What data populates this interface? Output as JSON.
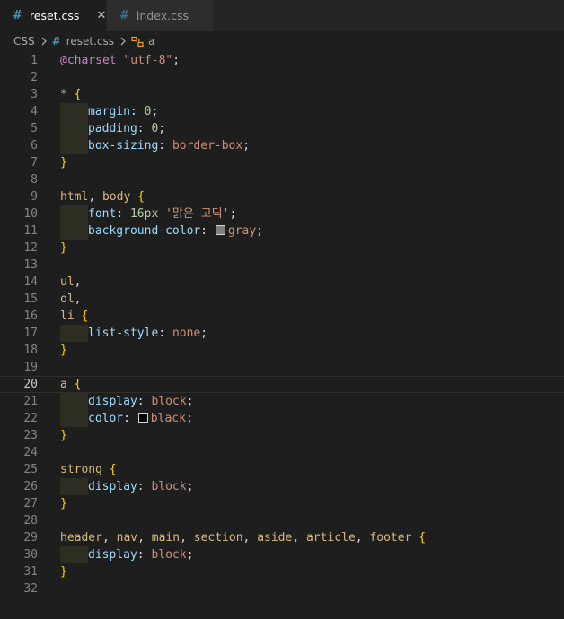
{
  "tabs": [
    {
      "label": "reset.css",
      "active": true,
      "close_glyph": "✕"
    },
    {
      "label": "index.css",
      "active": false
    }
  ],
  "breadcrumb": {
    "root": "CSS",
    "file": "reset.css",
    "symbol": "a"
  },
  "editor": {
    "current_line": 20,
    "lines": [
      {
        "n": "1",
        "indent": false,
        "tokens": [
          [
            "at",
            "@charset"
          ],
          [
            "punc",
            " "
          ],
          [
            "str",
            "\"utf-8\""
          ],
          [
            "punc",
            ";"
          ]
        ]
      },
      {
        "n": "2",
        "indent": false,
        "tokens": []
      },
      {
        "n": "3",
        "indent": false,
        "tokens": [
          [
            "sel",
            "*"
          ],
          [
            "punc",
            " "
          ],
          [
            "brace",
            "{"
          ]
        ]
      },
      {
        "n": "4",
        "indent": true,
        "tokens": [
          [
            "prop",
            "margin"
          ],
          [
            "punc",
            ": "
          ],
          [
            "num",
            "0"
          ],
          [
            "punc",
            ";"
          ]
        ]
      },
      {
        "n": "5",
        "indent": true,
        "tokens": [
          [
            "prop",
            "padding"
          ],
          [
            "punc",
            ": "
          ],
          [
            "num",
            "0"
          ],
          [
            "punc",
            ";"
          ]
        ]
      },
      {
        "n": "6",
        "indent": true,
        "tokens": [
          [
            "prop",
            "box-sizing"
          ],
          [
            "punc",
            ": "
          ],
          [
            "val",
            "border-box"
          ],
          [
            "punc",
            ";"
          ]
        ]
      },
      {
        "n": "7",
        "indent": false,
        "tokens": [
          [
            "brace",
            "}"
          ]
        ]
      },
      {
        "n": "8",
        "indent": false,
        "tokens": []
      },
      {
        "n": "9",
        "indent": false,
        "tokens": [
          [
            "sel",
            "html"
          ],
          [
            "punc",
            ", "
          ],
          [
            "sel",
            "body"
          ],
          [
            "punc",
            " "
          ],
          [
            "brace",
            "{"
          ]
        ]
      },
      {
        "n": "10",
        "indent": true,
        "tokens": [
          [
            "prop",
            "font"
          ],
          [
            "punc",
            ": "
          ],
          [
            "num",
            "16px"
          ],
          [
            "punc",
            " "
          ],
          [
            "str",
            "'맑은 고딕'"
          ],
          [
            "punc",
            ";"
          ]
        ]
      },
      {
        "n": "11",
        "indent": true,
        "tokens": [
          [
            "prop",
            "background-color"
          ],
          [
            "punc",
            ": "
          ],
          [
            "swatch",
            "#808080"
          ],
          [
            "val",
            "gray"
          ],
          [
            "punc",
            ";"
          ]
        ]
      },
      {
        "n": "12",
        "indent": false,
        "tokens": [
          [
            "brace",
            "}"
          ]
        ]
      },
      {
        "n": "13",
        "indent": false,
        "tokens": []
      },
      {
        "n": "14",
        "indent": false,
        "tokens": [
          [
            "sel",
            "ul"
          ],
          [
            "punc",
            ","
          ]
        ]
      },
      {
        "n": "15",
        "indent": false,
        "tokens": [
          [
            "sel",
            "ol"
          ],
          [
            "punc",
            ","
          ]
        ]
      },
      {
        "n": "16",
        "indent": false,
        "tokens": [
          [
            "sel",
            "li"
          ],
          [
            "punc",
            " "
          ],
          [
            "brace",
            "{"
          ]
        ]
      },
      {
        "n": "17",
        "indent": true,
        "tokens": [
          [
            "prop",
            "list-style"
          ],
          [
            "punc",
            ": "
          ],
          [
            "val",
            "none"
          ],
          [
            "punc",
            ";"
          ]
        ]
      },
      {
        "n": "18",
        "indent": false,
        "tokens": [
          [
            "brace",
            "}"
          ]
        ]
      },
      {
        "n": "19",
        "indent": false,
        "tokens": []
      },
      {
        "n": "20",
        "indent": false,
        "tokens": [
          [
            "sel",
            "a"
          ],
          [
            "punc",
            " "
          ],
          [
            "brace",
            "{"
          ]
        ]
      },
      {
        "n": "21",
        "indent": true,
        "tokens": [
          [
            "prop",
            "display"
          ],
          [
            "punc",
            ": "
          ],
          [
            "val",
            "block"
          ],
          [
            "punc",
            ";"
          ]
        ]
      },
      {
        "n": "22",
        "indent": true,
        "tokens": [
          [
            "prop",
            "color"
          ],
          [
            "punc",
            ": "
          ],
          [
            "swatch",
            "#000000"
          ],
          [
            "val",
            "black"
          ],
          [
            "punc",
            ";"
          ]
        ]
      },
      {
        "n": "23",
        "indent": false,
        "tokens": [
          [
            "brace",
            "}"
          ]
        ]
      },
      {
        "n": "24",
        "indent": false,
        "tokens": []
      },
      {
        "n": "25",
        "indent": false,
        "tokens": [
          [
            "sel",
            "strong"
          ],
          [
            "punc",
            " "
          ],
          [
            "brace",
            "{"
          ]
        ]
      },
      {
        "n": "26",
        "indent": true,
        "tokens": [
          [
            "prop",
            "display"
          ],
          [
            "punc",
            ": "
          ],
          [
            "val",
            "block"
          ],
          [
            "punc",
            ";"
          ]
        ]
      },
      {
        "n": "27",
        "indent": false,
        "tokens": [
          [
            "brace",
            "}"
          ]
        ]
      },
      {
        "n": "28",
        "indent": false,
        "tokens": []
      },
      {
        "n": "29",
        "indent": false,
        "tokens": [
          [
            "sel",
            "header"
          ],
          [
            "punc",
            ", "
          ],
          [
            "sel",
            "nav"
          ],
          [
            "punc",
            ", "
          ],
          [
            "sel",
            "main"
          ],
          [
            "punc",
            ", "
          ],
          [
            "sel",
            "section"
          ],
          [
            "punc",
            ", "
          ],
          [
            "sel",
            "aside"
          ],
          [
            "punc",
            ", "
          ],
          [
            "sel",
            "article"
          ],
          [
            "punc",
            ", "
          ],
          [
            "sel",
            "footer"
          ],
          [
            "punc",
            " "
          ],
          [
            "brace",
            "{"
          ]
        ]
      },
      {
        "n": "30",
        "indent": true,
        "tokens": [
          [
            "prop",
            "display"
          ],
          [
            "punc",
            ": "
          ],
          [
            "val",
            "block"
          ],
          [
            "punc",
            ";"
          ]
        ]
      },
      {
        "n": "31",
        "indent": false,
        "tokens": [
          [
            "brace",
            "}"
          ]
        ]
      },
      {
        "n": "32",
        "indent": false,
        "tokens": []
      }
    ]
  },
  "colors": {
    "background": "#1e1e1e",
    "tab_bar": "#252526",
    "css_icon": "#519aba",
    "selector": "#d7ba7d",
    "brace": "#ffd700",
    "property": "#9cdcfe",
    "number": "#b5cea8",
    "value": "#ce9178",
    "at_rule": "#c586c0"
  }
}
